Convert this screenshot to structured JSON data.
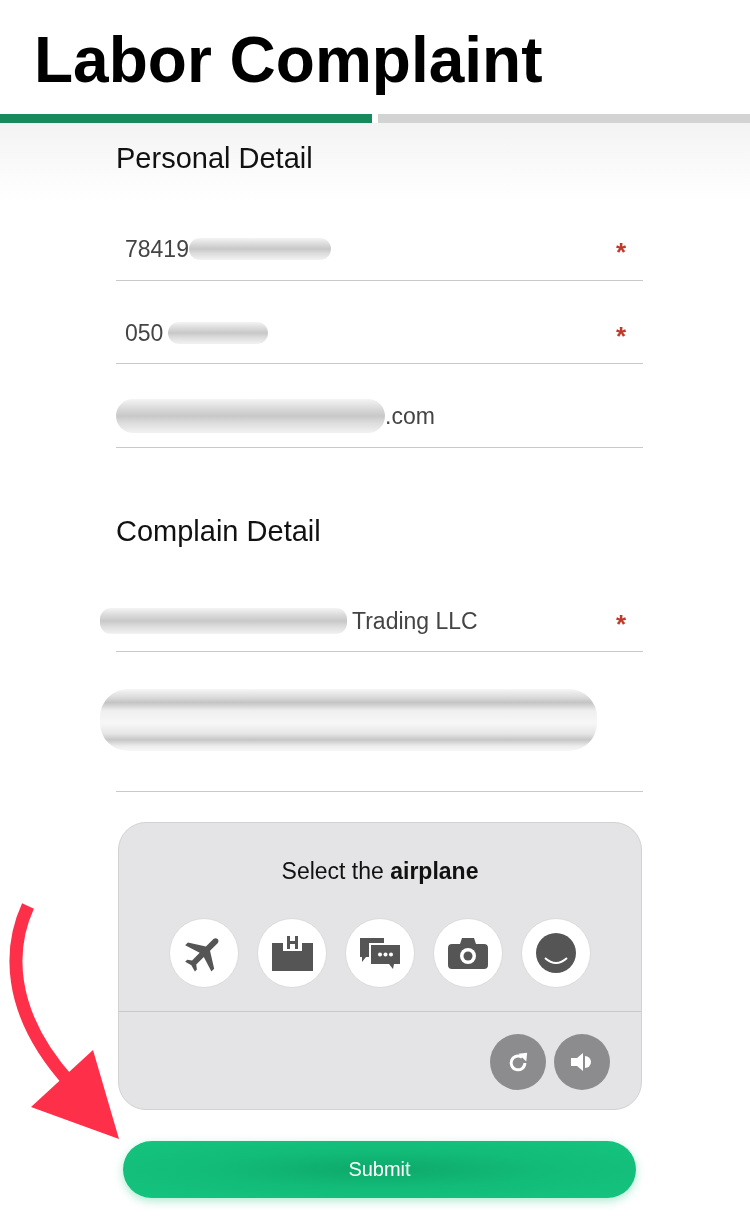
{
  "title": "Labor Complaint",
  "steps": [
    {
      "completed": true
    },
    {
      "completed": false
    }
  ],
  "sections": [
    {
      "heading": "Personal Detail",
      "fields": [
        {
          "kind": "input",
          "value": "78419",
          "redacted_after": true,
          "required_mark": "*"
        },
        {
          "kind": "input",
          "value": "050",
          "redacted_after": true,
          "required_mark": "*"
        },
        {
          "kind": "input",
          "value": ".com",
          "redacted_before": true
        }
      ]
    },
    {
      "heading": "Complain Detail",
      "fields": [
        {
          "kind": "input",
          "value": "Trading LLC",
          "redacted_before": true,
          "required_mark": "*"
        },
        {
          "kind": "textarea",
          "redacted": true
        }
      ]
    }
  ],
  "captcha": {
    "instruction": "Select the **airplane**",
    "options": [
      {
        "selected": false
      },
      {
        "selected": false
      },
      {
        "selected": false
      },
      {
        "selected": false
      },
      {
        "selected": false
      }
    ]
  },
  "submit_button": "Submit"
}
